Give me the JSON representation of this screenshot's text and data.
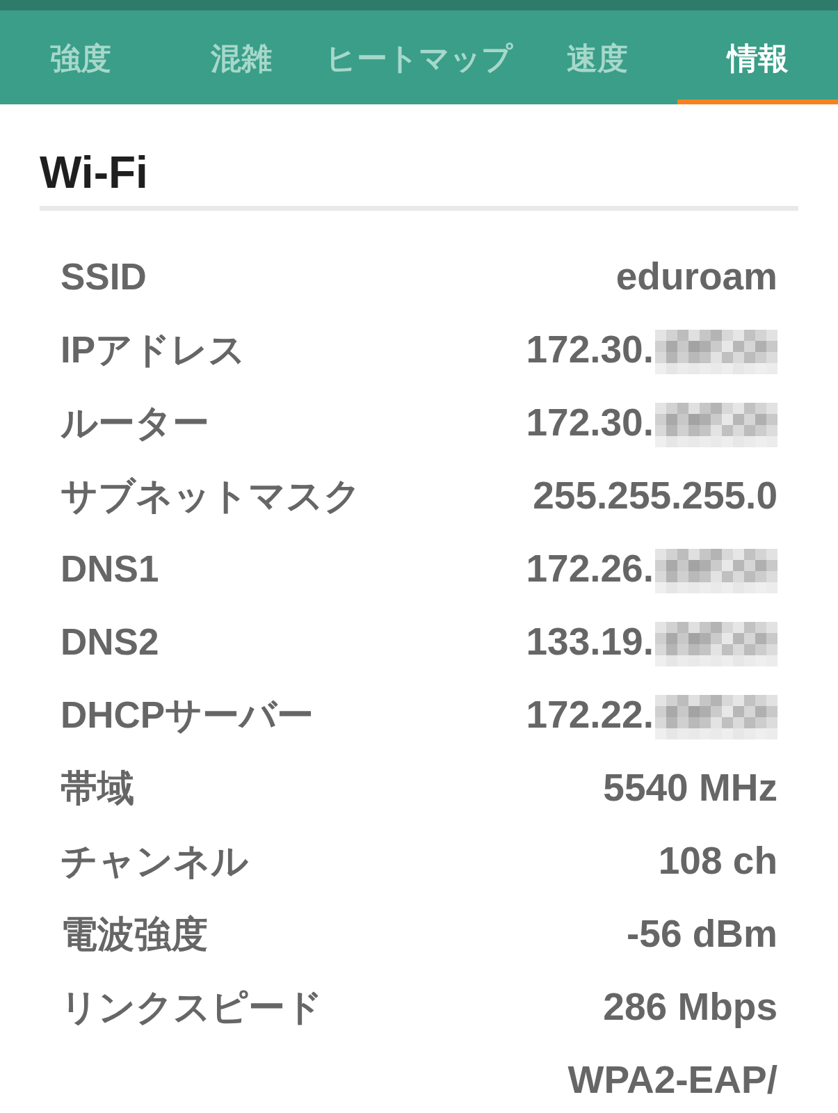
{
  "tabs": [
    {
      "label": "強度",
      "selected": false
    },
    {
      "label": "混雑",
      "selected": false
    },
    {
      "label": "ヒートマップ",
      "selected": false
    },
    {
      "label": "速度",
      "selected": false
    },
    {
      "label": "情報",
      "selected": true
    }
  ],
  "section": {
    "title": "Wi-Fi",
    "rows": [
      {
        "label": "SSID",
        "value": "eduroam",
        "redacted": false
      },
      {
        "label": "IPアドレス",
        "value": "172.30.",
        "redacted": true
      },
      {
        "label": "ルーター",
        "value": "172.30.",
        "redacted": true
      },
      {
        "label": "サブネットマスク",
        "value": "255.255.255.0",
        "redacted": false
      },
      {
        "label": "DNS1",
        "value": "172.26.",
        "redacted": true
      },
      {
        "label": "DNS2",
        "value": "133.19.",
        "redacted": true
      },
      {
        "label": "DHCPサーバー",
        "value": "172.22.",
        "redacted": true
      },
      {
        "label": "帯域",
        "value": "5540 MHz",
        "redacted": false
      },
      {
        "label": "チャンネル",
        "value": "108 ch",
        "redacted": false
      },
      {
        "label": "電波強度",
        "value": "-56 dBm",
        "redacted": false
      },
      {
        "label": "リンクスピード",
        "value": "286 Mbps",
        "redacted": false
      },
      {
        "value": "WPA2-EAP/",
        "redacted": false
      }
    ]
  }
}
